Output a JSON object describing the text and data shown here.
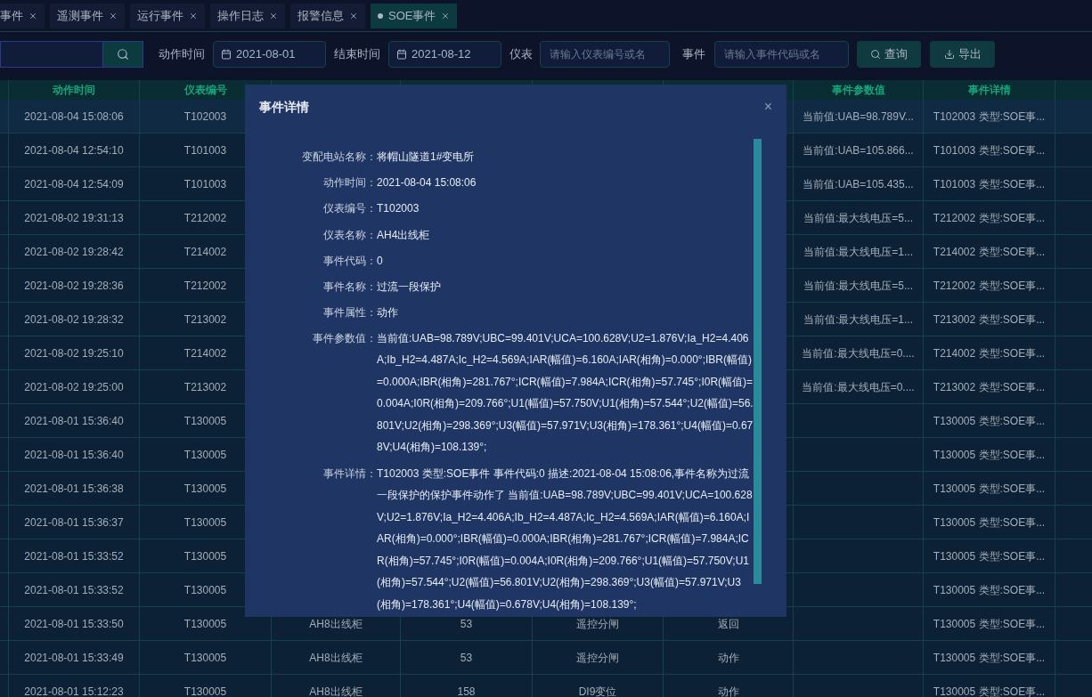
{
  "tabs": [
    {
      "label": "事件",
      "selected": false
    },
    {
      "label": "遥测事件",
      "selected": false
    },
    {
      "label": "运行事件",
      "selected": false
    },
    {
      "label": "操作日志",
      "selected": false
    },
    {
      "label": "报警信息",
      "selected": false
    },
    {
      "label": "SOE事件",
      "selected": true
    }
  ],
  "filters": {
    "start_label": "动作时间",
    "start_date": "2021-08-01",
    "end_label": "结束时间",
    "end_date": "2021-08-12",
    "meter_label": "仪表",
    "meter_placeholder": "请输入仪表编号或名",
    "event_label": "事件",
    "event_placeholder": "请输入事件代码或名",
    "query_button": "查询",
    "export_button": "导出"
  },
  "table": {
    "columns": [
      "动作时间",
      "仪表编号",
      "事件参数值",
      "事件详情"
    ],
    "rows": [
      {
        "selected": true,
        "time": "2021-08-04 15:08:06",
        "meter": "T102003",
        "params": "当前值:UAB=98.789V...",
        "detail": "T102003 类型:SOE事..."
      },
      {
        "selected": false,
        "time": "2021-08-04 12:54:10",
        "meter": "T101003",
        "params": "当前值:UAB=105.866...",
        "detail": "T101003 类型:SOE事..."
      },
      {
        "selected": false,
        "time": "2021-08-04 12:54:09",
        "meter": "T101003",
        "params": "当前值:UAB=105.435...",
        "detail": "T101003 类型:SOE事..."
      },
      {
        "selected": false,
        "time": "2021-08-02 19:31:13",
        "meter": "T212002",
        "params": "当前值:最大线电压=5...",
        "detail": "T212002 类型:SOE事..."
      },
      {
        "selected": false,
        "time": "2021-08-02 19:28:42",
        "meter": "T214002",
        "params": "当前值:最大线电压=1...",
        "detail": "T214002 类型:SOE事..."
      },
      {
        "selected": false,
        "time": "2021-08-02 19:28:36",
        "meter": "T212002",
        "params": "当前值:最大线电压=5...",
        "detail": "T212002 类型:SOE事..."
      },
      {
        "selected": false,
        "time": "2021-08-02 19:28:32",
        "meter": "T213002",
        "params": "当前值:最大线电压=1...",
        "detail": "T213002 类型:SOE事..."
      },
      {
        "selected": false,
        "time": "2021-08-02 19:25:10",
        "meter": "T214002",
        "params": "当前值:最大线电压=0....",
        "detail": "T214002 类型:SOE事..."
      },
      {
        "selected": false,
        "time": "2021-08-02 19:25:00",
        "meter": "T213002",
        "params": "当前值:最大线电压=0....",
        "detail": "T213002 类型:SOE事..."
      },
      {
        "selected": false,
        "time": "2021-08-01 15:36:40",
        "meter": "T130005",
        "detail": "T130005 类型:SOE事..."
      },
      {
        "selected": false,
        "time": "2021-08-01 15:36:40",
        "meter": "T130005",
        "detail": "T130005 类型:SOE事..."
      },
      {
        "selected": false,
        "time": "2021-08-01 15:36:38",
        "meter": "T130005",
        "detail": "T130005 类型:SOE事..."
      },
      {
        "selected": false,
        "time": "2021-08-01 15:36:37",
        "meter": "T130005",
        "detail": "T130005 类型:SOE事..."
      },
      {
        "selected": false,
        "time": "2021-08-01 15:33:52",
        "meter": "T130005",
        "detail": "T130005 类型:SOE事..."
      },
      {
        "selected": false,
        "time": "2021-08-01 15:33:52",
        "meter": "T130005",
        "detail": "T130005 类型:SOE事..."
      },
      {
        "selected": false,
        "time": "2021-08-01 15:33:50",
        "meter": "T130005",
        "meter_name": "AH8出线柜",
        "code": "53",
        "event_name": "遥控分闸",
        "attribute": "返回",
        "detail": "T130005 类型:SOE事..."
      },
      {
        "selected": false,
        "time": "2021-08-01 15:33:49",
        "meter": "T130005",
        "meter_name": "AH8出线柜",
        "code": "53",
        "event_name": "遥控分闸",
        "attribute": "动作",
        "detail": "T130005 类型:SOE事..."
      },
      {
        "selected": false,
        "time": "2021-08-01 15:12:23",
        "meter": "T130005",
        "meter_name": "AH8出线柜",
        "code": "158",
        "event_name": "DI9变位",
        "attribute": "动作",
        "detail": "T130005 类型:SOE事..."
      }
    ]
  },
  "dialog": {
    "title": "事件详情",
    "close": "×",
    "fields": [
      {
        "label": "变配电站名称：",
        "value": "将帽山隧道1#变电所"
      },
      {
        "label": "动作时间：",
        "value": "2021-08-04 15:08:06"
      },
      {
        "label": "仪表编号：",
        "value": "T102003"
      },
      {
        "label": "仪表名称：",
        "value": "AH4出线柜"
      },
      {
        "label": "事件代码：",
        "value": "0"
      },
      {
        "label": "事件名称：",
        "value": "过流一段保护"
      },
      {
        "label": "事件属性：",
        "value": "动作"
      },
      {
        "label": "事件参数值：",
        "value": "当前值:UAB=98.789V;UBC=99.401V;UCA=100.628V;U2=1.876V;Ia_H2=4.406A;Ib_H2=4.487A;Ic_H2=4.569A;IAR(幅值)=6.160A;IAR(相角)=0.000°;IBR(幅值)=0.000A;IBR(相角)=281.767°;ICR(幅值)=7.984A;ICR(相角)=57.745°;I0R(幅值)=0.004A;I0R(相角)=209.766°;U1(幅值)=57.750V;U1(相角)=57.544°;U2(幅值)=56.801V;U2(相角)=298.369°;U3(幅值)=57.971V;U3(相角)=178.361°;U4(幅值)=0.678V;U4(相角)=108.139°;"
      },
      {
        "label": "事件详情：",
        "value": "T102003 类型:SOE事件 事件代码:0 描述:2021-08-04 15:08:06,事件名称为过流一段保护的保护事件动作了 当前值:UAB=98.789V;UBC=99.401V;UCA=100.628V;U2=1.876V;Ia_H2=4.406A;Ib_H2=4.487A;Ic_H2=4.569A;IAR(幅值)=6.160A;IAR(相角)=0.000°;IBR(幅值)=0.000A;IBR(相角)=281.767°;ICR(幅值)=7.984A;ICR(相角)=57.745°;I0R(幅值)=0.004A;I0R(相角)=209.766°;U1(幅值)=57.750V;U1(相角)=57.544°;U2(幅值)=56.801V;U2(相角)=298.369°;U3(幅值)=57.971V;U3(相角)=178.361°;U4(幅值)=0.678V;U4(相角)=108.139°;"
      }
    ]
  }
}
